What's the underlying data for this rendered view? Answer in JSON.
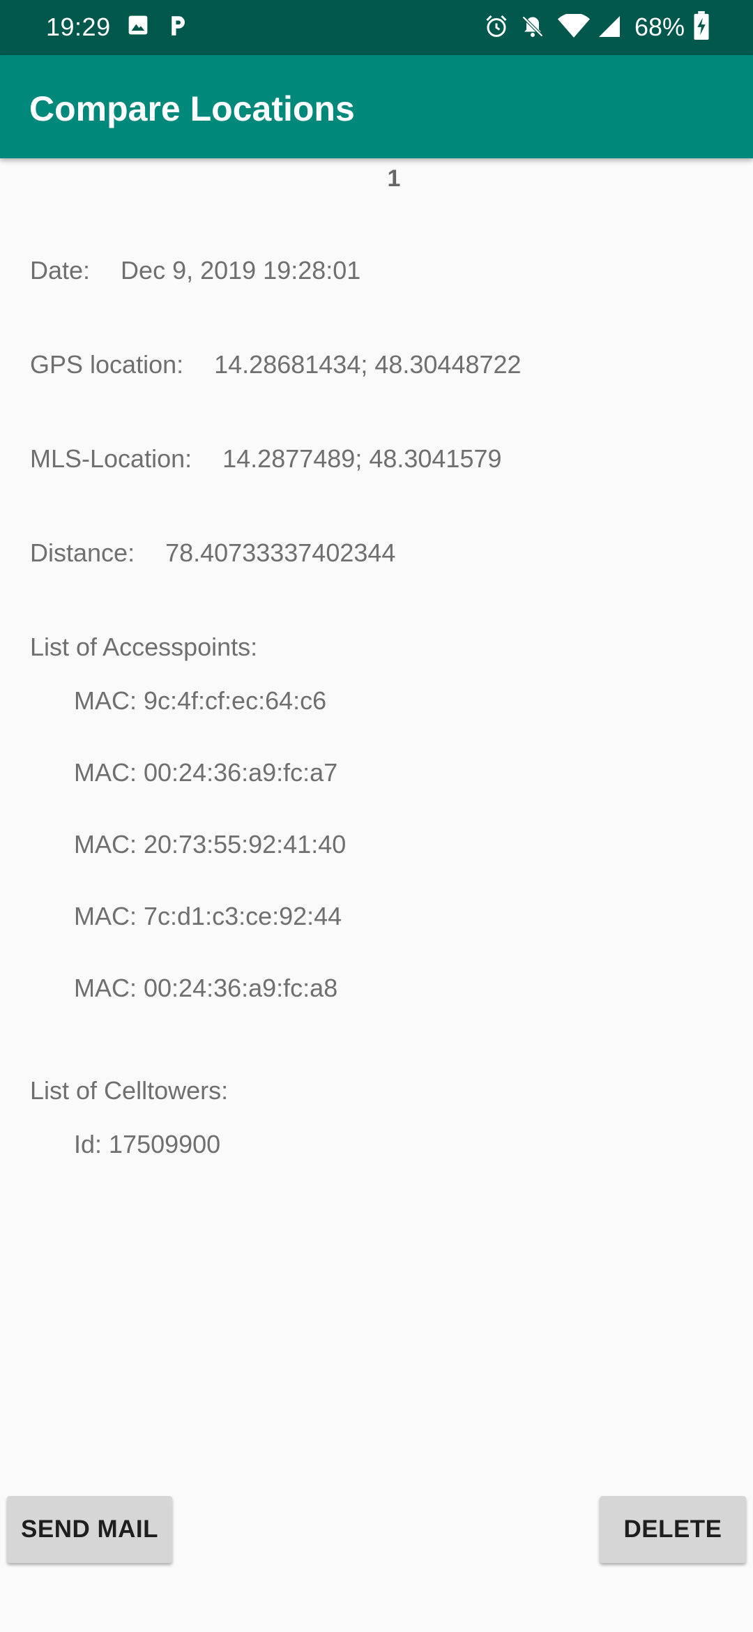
{
  "status_bar": {
    "time": "19:29",
    "battery": "68%",
    "icons": [
      "image-icon",
      "parking-icon",
      "alarm-icon",
      "notifications-off-icon",
      "wifi-icon",
      "signal-icon",
      "battery-charging-icon"
    ]
  },
  "app_bar": {
    "title": "Compare Locations"
  },
  "record": {
    "index": "1",
    "date_label": "Date:",
    "date_value": "Dec 9, 2019 19:28:01",
    "gps_label": "GPS location:",
    "gps_value": "14.28681434; 48.30448722",
    "mls_label": "MLS-Location:",
    "mls_value": "14.2877489; 48.3041579",
    "distance_label": "Distance:",
    "distance_value": "78.40733337402344"
  },
  "accesspoints": {
    "label": "List of Accesspoints:",
    "items": [
      "MAC: 9c:4f:cf:ec:64:c6",
      "MAC: 00:24:36:a9:fc:a7",
      "MAC: 20:73:55:92:41:40",
      "MAC: 7c:d1:c3:ce:92:44",
      "MAC: 00:24:36:a9:fc:a8"
    ]
  },
  "celltowers": {
    "label": "List of Celltowers:",
    "items": [
      "Id: 17509900"
    ]
  },
  "actions": {
    "send_mail": "SEND MAIL",
    "delete": "DELETE"
  },
  "colors": {
    "status_bar": "#00574b",
    "app_bar": "#00897b",
    "background": "#fafafa",
    "button": "#d6d6d6",
    "text": "#6f6f6f"
  }
}
